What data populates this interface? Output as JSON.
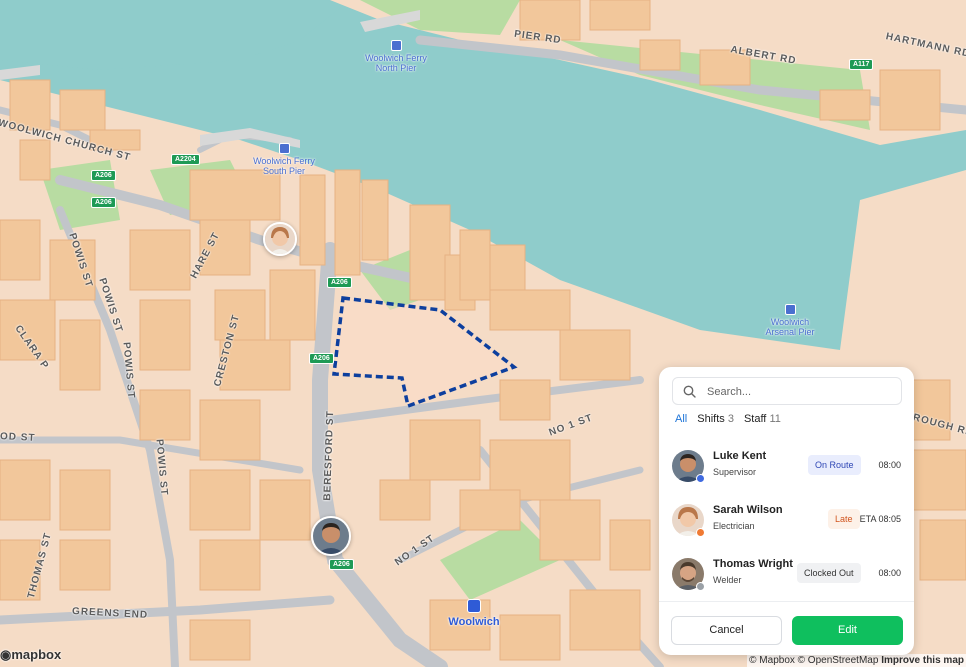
{
  "map": {
    "pois": [
      {
        "id": "north-pier",
        "label_lines": [
          "Woolwich Ferry",
          "North Pier"
        ]
      },
      {
        "id": "south-pier",
        "label_lines": [
          "Woolwich Ferry",
          "South Pier"
        ]
      },
      {
        "id": "arsenal-pier",
        "label_lines": [
          "Woolwich",
          "Arsenal Pier"
        ]
      }
    ],
    "station": {
      "label": "Woolwich"
    },
    "road_shields": [
      "A206",
      "A206",
      "A2204",
      "A206",
      "A206",
      "A206",
      "A117"
    ],
    "streets": [
      "PIER RD",
      "ALBERT RD",
      "HARTMANN RD",
      "WOOLWICH CHURCH ST",
      "POWIS ST",
      "POWIS ST",
      "POWIS ST",
      "POWIS ST",
      "HARE ST",
      "CRESTON ST",
      "BERESFORD ST",
      "NO 1 ST",
      "NO 1 ST",
      "GREENS END",
      "THOMAS ST",
      "ROUGH RD",
      "OD ST",
      "CLARA P"
    ],
    "logo": "mapbox",
    "attribution": {
      "text": "© Mapbox © OpenStreetMap",
      "improve": "Improve this map"
    },
    "colors": {
      "water": "#8fcccb",
      "land": "#f5dcc6",
      "building": "#f2c79b",
      "park": "#b8dca2",
      "road": "#c2c5ca",
      "zone": "#0d3f9e"
    }
  },
  "panel": {
    "search_placeholder": "Search...",
    "tabs": [
      {
        "label": "All",
        "count": ""
      },
      {
        "label": "Shifts",
        "count": "3"
      },
      {
        "label": "Staff",
        "count": "11"
      }
    ],
    "staff": [
      {
        "name": "Luke Kent",
        "role": "Supervisor",
        "status": "On Route",
        "time": "08:00",
        "status_color": "#e9edfd",
        "status_text_color": "#2f47b5",
        "dot_color": "#3f6ae0"
      },
      {
        "name": "Sarah Wilson",
        "role": "Electrician",
        "status": "Late",
        "time": "ETA 08:05",
        "status_color": "#fdf1e8",
        "status_text_color": "#d1551f",
        "dot_color": "#f07a33"
      },
      {
        "name": "Thomas Wright",
        "role": "Welder",
        "status": "Clocked Out",
        "time": "08:00",
        "status_color": "#f0f1f3",
        "status_text_color": "#333333",
        "dot_color": "#9aa0a6"
      }
    ],
    "cancel_label": "Cancel",
    "edit_label": "Edit"
  }
}
